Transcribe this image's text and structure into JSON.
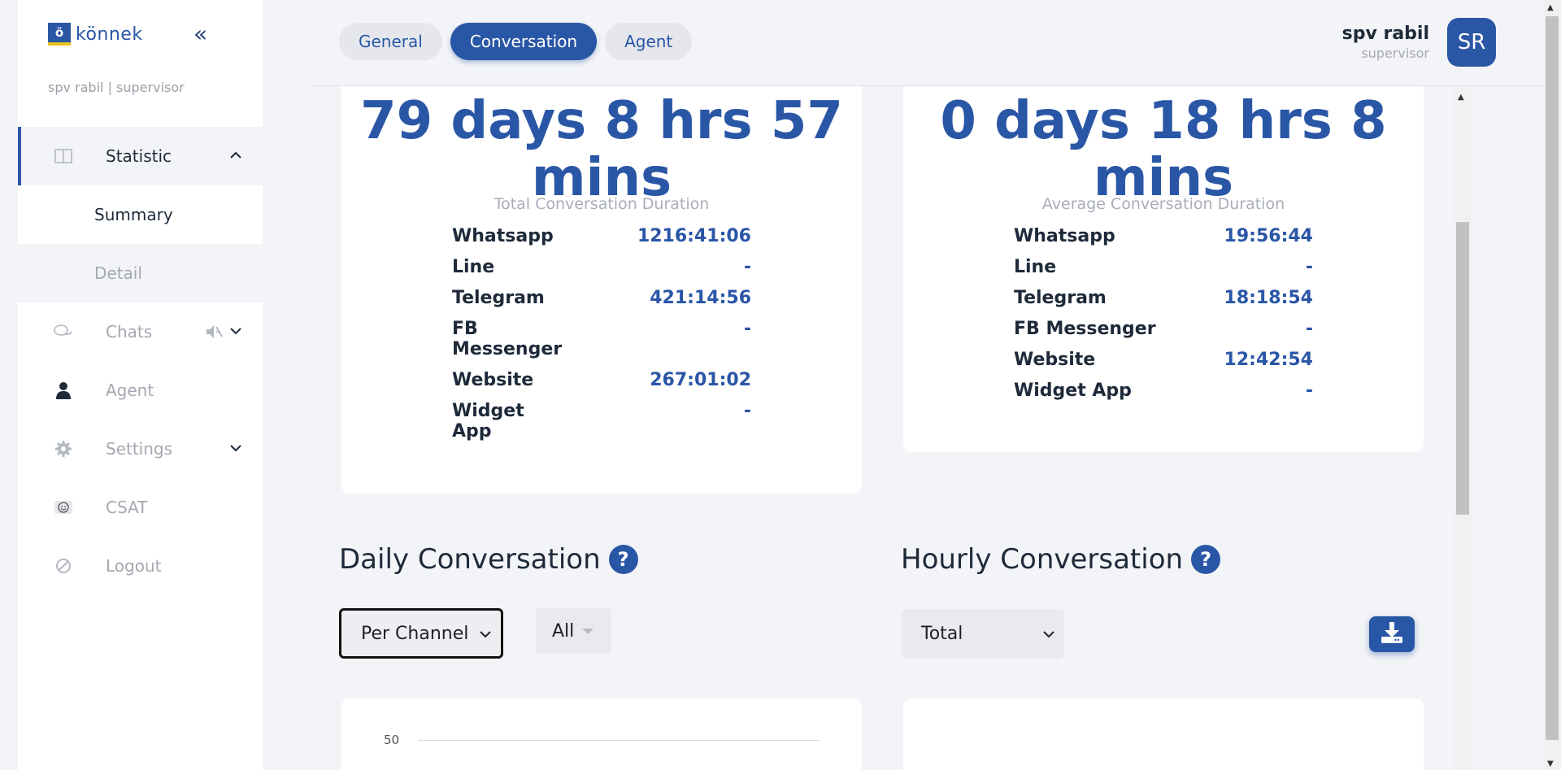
{
  "sidebar": {
    "logo_mark": "ö",
    "logo_text": "könnek",
    "collapse_icon": "«",
    "user_role": "spv rabil | supervisor",
    "items": [
      {
        "label": "Statistic",
        "icon": "layout-columns-icon"
      },
      {
        "label": "Chats",
        "icon": "chat-bubbles-icon"
      },
      {
        "label": "Agent",
        "icon": "person-icon"
      },
      {
        "label": "Settings",
        "icon": "gear-icon"
      },
      {
        "label": "CSAT",
        "icon": "smiley-icon"
      },
      {
        "label": "Logout",
        "icon": "logout-icon"
      }
    ],
    "sub_items": [
      {
        "label": "Summary"
      },
      {
        "label": "Detail"
      }
    ]
  },
  "header": {
    "tabs": [
      {
        "label": "General"
      },
      {
        "label": "Conversation"
      },
      {
        "label": "Agent"
      }
    ],
    "user_name": "spv rabil",
    "user_sub": "supervisor",
    "avatar_initials": "SR"
  },
  "total_card": {
    "big_value_line1": "79 days 8 hrs 57",
    "big_value_line2": "mins",
    "caption": "Total Conversation Duration",
    "rows": [
      {
        "name": "Whatsapp",
        "value": "1216:41:06"
      },
      {
        "name": "Line",
        "value": "-"
      },
      {
        "name": "Telegram",
        "value": "421:14:56"
      },
      {
        "name": "FB\nMessenger",
        "value": "-"
      },
      {
        "name": "Website",
        "value": "267:01:02"
      },
      {
        "name": "Widget\nApp",
        "value": "-"
      }
    ]
  },
  "average_card": {
    "big_value_line1": "0 days 18 hrs 8",
    "big_value_line2": "mins",
    "caption": "Average Conversation Duration",
    "rows": [
      {
        "name": "Whatsapp",
        "value": "19:56:44"
      },
      {
        "name": "Line",
        "value": "-"
      },
      {
        "name": "Telegram",
        "value": "18:18:54"
      },
      {
        "name": "FB Messenger",
        "value": "-"
      },
      {
        "name": "Website",
        "value": "12:42:54"
      },
      {
        "name": "Widget App",
        "value": "-"
      }
    ]
  },
  "daily": {
    "title": "Daily Conversation",
    "help": "?",
    "select_value": "Per Channel",
    "filter_value": "All",
    "chart_tick": "50"
  },
  "hourly": {
    "title": "Hourly Conversation",
    "help": "?",
    "select_value": "Total"
  },
  "colors": {
    "accent": "#2a56a6",
    "background": "#f3f4f7"
  }
}
